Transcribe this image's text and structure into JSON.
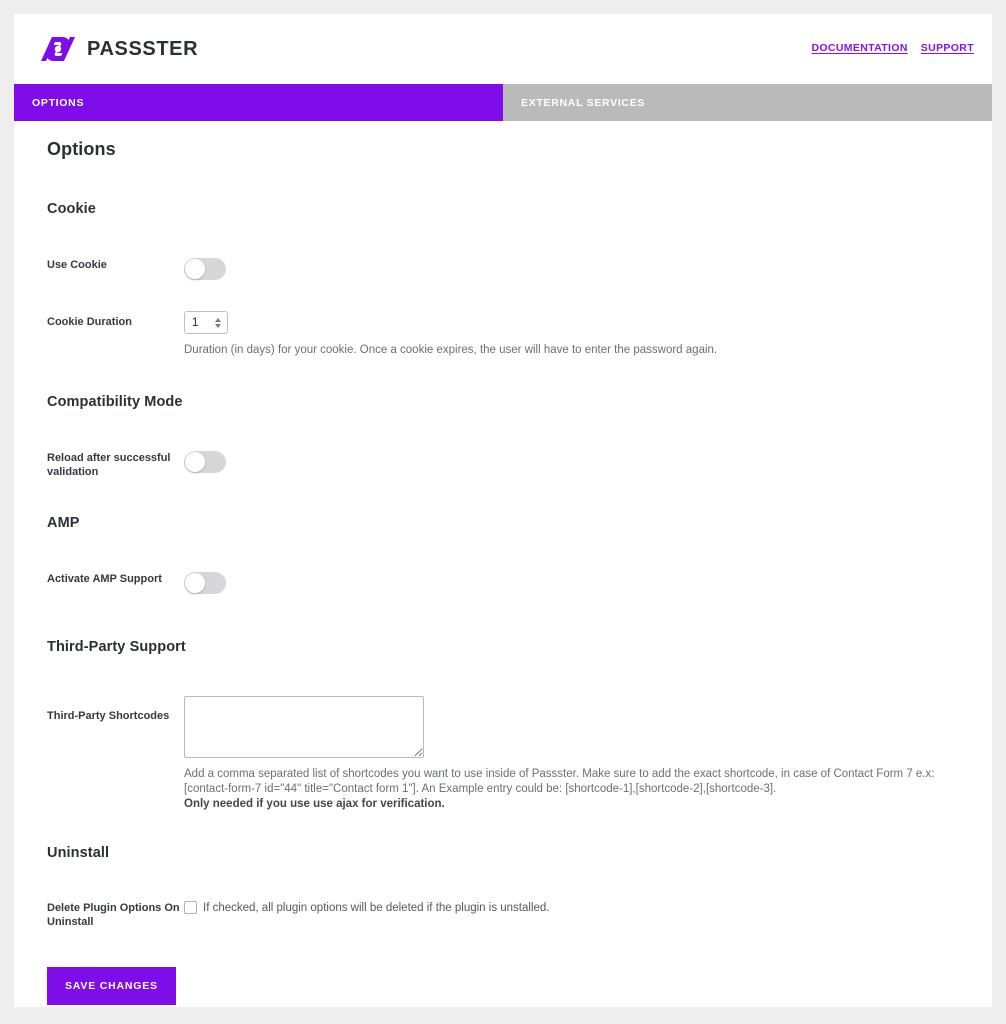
{
  "brand": {
    "name": "PASSSTER",
    "logo_icon": "passster-logo-icon",
    "accent_color": "#7f0dea"
  },
  "header": {
    "links": [
      {
        "label": "DOCUMENTATION"
      },
      {
        "label": "SUPPORT"
      }
    ]
  },
  "tabs": [
    {
      "label": "OPTIONS",
      "active": true
    },
    {
      "label": "EXTERNAL SERVICES",
      "active": false
    }
  ],
  "page": {
    "title": "Options"
  },
  "sections": {
    "cookie": {
      "title": "Cookie",
      "use_cookie": {
        "label": "Use Cookie",
        "value": "off"
      },
      "duration": {
        "label": "Cookie Duration",
        "value": "1",
        "hint": "Duration (in days) for your cookie. Once a cookie expires, the user will have to enter the password again."
      }
    },
    "compatibility": {
      "title": "Compatibility Mode",
      "reload": {
        "label": "Reload after successful validation",
        "value": "off"
      }
    },
    "amp": {
      "title": "AMP",
      "activate": {
        "label": "Activate AMP Support",
        "value": "off"
      }
    },
    "third_party": {
      "title": "Third-Party Support",
      "shortcodes": {
        "label": "Third-Party Shortcodes",
        "value": "",
        "placeholder": "",
        "hint_line1": "Add a comma separated list of shortcodes you want to use inside of Passster. Make sure to add the exact shortcode, in case of Contact Form 7 e.x: [contact-form-7 id=\"44\" title=\"Contact form 1\"]. An Example entry could be: [shortcode-1],[shortcode-2],[shortcode-3].",
        "hint_line2": "Only needed if you use use ajax for verification."
      }
    },
    "uninstall": {
      "title": "Uninstall",
      "delete_options": {
        "label": "Delete Plugin Options On Uninstall",
        "checkbox_text": "If checked, all plugin options will be deleted if the plugin is unstalled.",
        "checked": false
      }
    }
  },
  "footer": {
    "save_label": "SAVE CHANGES"
  }
}
